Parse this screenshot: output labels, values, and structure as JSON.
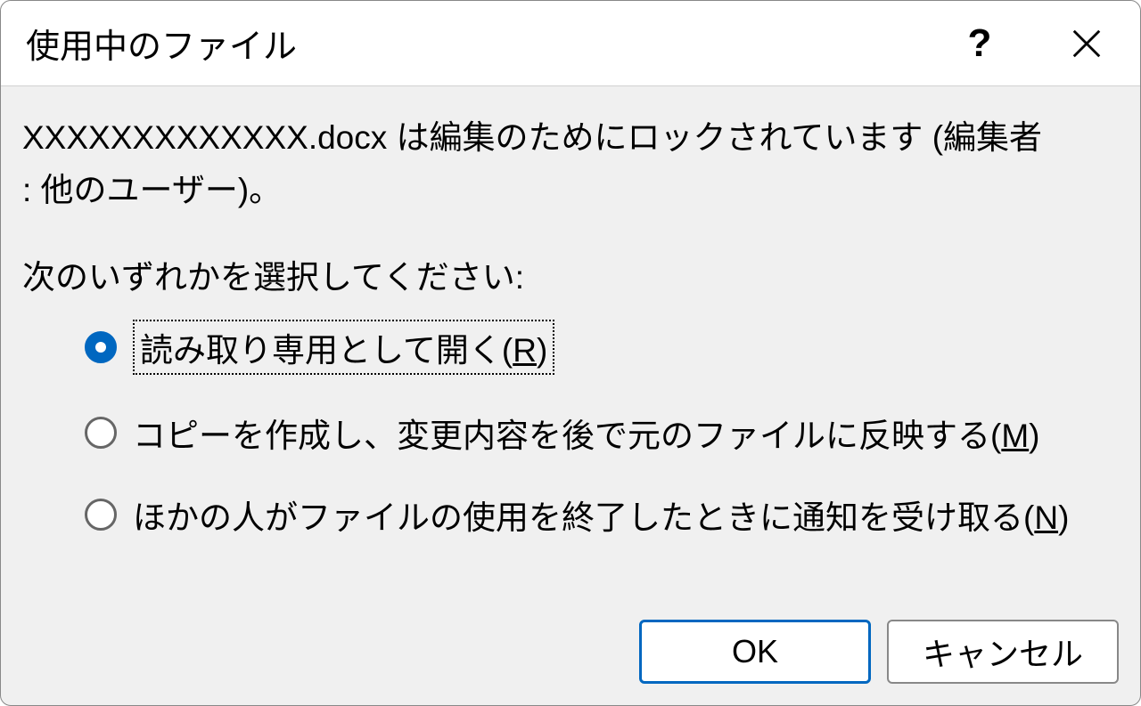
{
  "dialog": {
    "title": "使用中のファイル",
    "help": "?",
    "close": "×"
  },
  "message": {
    "filename": "XXXXXXXXXXXXX.docx",
    "locked_prefix": " は編集のためにロックされています (編集者",
    "locked_suffix": ": 他のユーザー)。"
  },
  "prompt": "次のいずれかを選択してください:",
  "options": {
    "readonly": {
      "label": "読み取り専用として開く(",
      "mnemonic": "R",
      "suffix": ")"
    },
    "copy": {
      "label": "コピーを作成し、変更内容を後で元のファイルに反映する(",
      "mnemonic": "M",
      "suffix": ")"
    },
    "notify": {
      "label": "ほかの人がファイルの使用を終了したときに通知を受け取る(",
      "mnemonic": "N",
      "suffix": ")"
    }
  },
  "buttons": {
    "ok": "OK",
    "cancel": "キャンセル"
  }
}
